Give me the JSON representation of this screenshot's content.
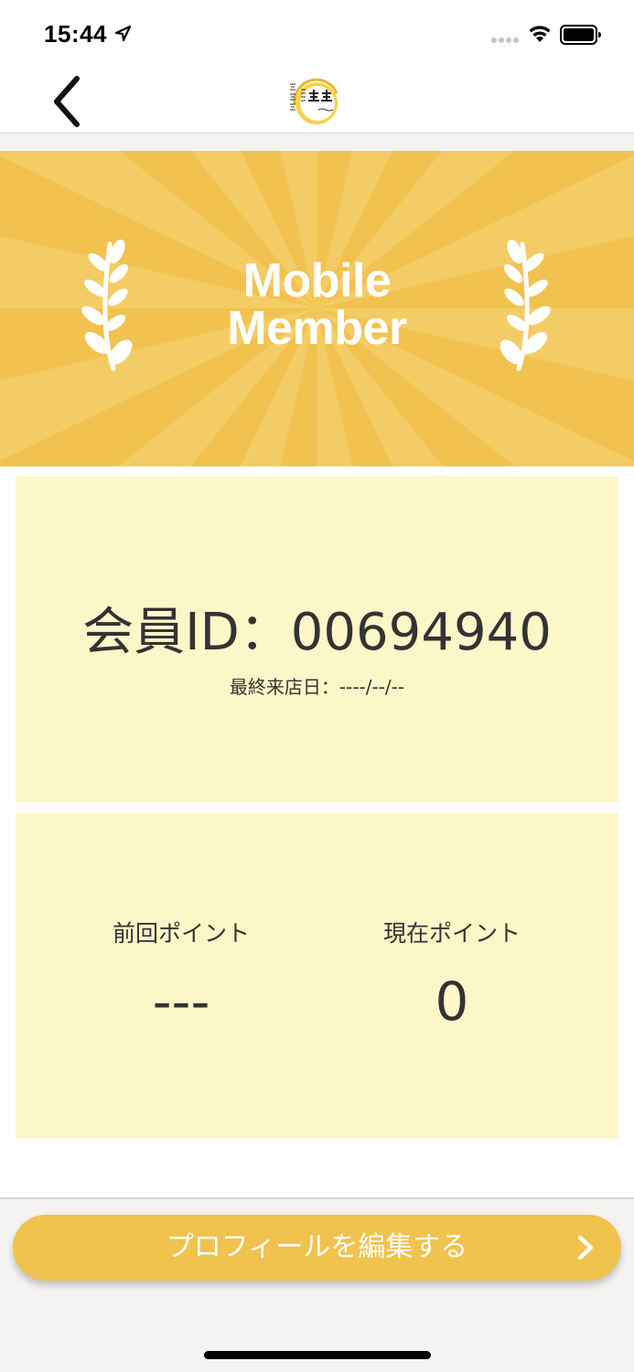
{
  "status_bar": {
    "time": "15:44"
  },
  "banner": {
    "title_line1": "Mobile",
    "title_line2": "Member"
  },
  "member": {
    "id_label": "会員ID：",
    "id_value": "00694940",
    "last_visit_label": "最終来店日：",
    "last_visit_value": "----/--/--"
  },
  "points": {
    "previous_label": "前回ポイント",
    "previous_value": "---",
    "current_label": "現在ポイント",
    "current_value": "0"
  },
  "actions": {
    "edit_profile_label": "プロフィールを編集する"
  },
  "colors": {
    "banner_yellow": "#f1c24f",
    "card_cream": "#fcf7c8",
    "button_yellow": "#f0c24e"
  },
  "icons": {
    "back": "chevron-left-icon",
    "edit_arrow": "chevron-right-icon",
    "laurel": "laurel-branch-icon"
  }
}
